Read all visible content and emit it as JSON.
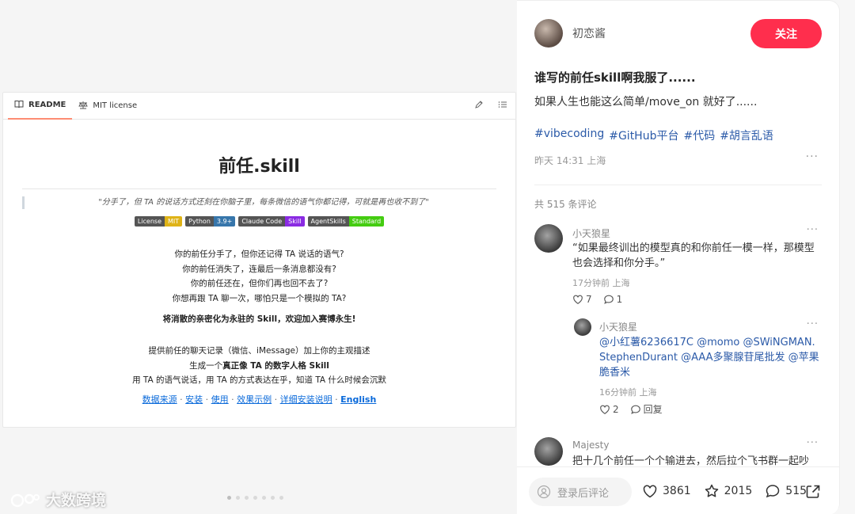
{
  "readme": {
    "tabs": [
      {
        "label": "README",
        "icon": "book-icon"
      },
      {
        "label": "MIT license",
        "icon": "scale-icon"
      }
    ],
    "title": "前任.skill",
    "quote": "\"分手了，但 TA 的说话方式还刻在你脑子里，每条微信的语气你都记得，可就是再也收不到了\"",
    "badges": [
      {
        "key": "License",
        "value": "MIT",
        "color": "#dfb317"
      },
      {
        "key": "Python",
        "value": "3.9+",
        "color": "#3776ab"
      },
      {
        "key": "Claude Code",
        "value": "Skill",
        "color": "#8a2be2"
      },
      {
        "key": "AgentSkills",
        "value": "Standard",
        "color": "#4c1"
      }
    ],
    "lines1": [
      "你的前任分手了，但你还记得 TA 说话的语气?",
      "你的前任消失了，连最后一条消息都没有?",
      "你的前任还在，但你们再也回不去了?",
      "你想再跟 TA 聊一次，哪怕只是一个模拟的 TA?"
    ],
    "bold_line": "将消散的亲密化为永驻的 Skill，欢迎加入赛博永生!",
    "lines2": {
      "l1": "提供前任的聊天记录（微信、iMessage）加上你的主观描述",
      "l2_pre": "生成一个",
      "l2_bold": "真正像 TA 的数字人格 Skill",
      "l3": "用 TA 的语气说话，用 TA 的方式表达在乎，知道 TA 什么时候会沉默"
    },
    "links": [
      "数据来源",
      "安装",
      "使用",
      "效果示例",
      "详细安装说明",
      "English"
    ],
    "sep": " · "
  },
  "watermark": "大数跨境",
  "post": {
    "author": "初恋酱",
    "follow_label": "关注",
    "title": "谁写的前任skill啊我服了......",
    "desc": "如果人生也能这么简单/move_on 就好了......",
    "tags": [
      "#vibecoding",
      "#GitHub平台",
      "#代码",
      "#胡言乱语"
    ],
    "meta": "昨天 14:31 上海",
    "more": "···",
    "comment_count": "共 515 条评论"
  },
  "comments": [
    {
      "name": "小天狼星",
      "text": "“如果最终训出的模型真的和你前任一模一样，那模型也会选择和你分手。”",
      "time": "17分钟前 上海",
      "likes": "7",
      "replies": "1"
    },
    {
      "name": "小天狼星",
      "mentions": "@小红薯6236617C @momo @SWiNGMAN.StephenDurant @AAA多聚腺苷尾批发 @苹果脆香米",
      "time": "16分钟前 上海",
      "likes": "2",
      "reply_label": "回复"
    },
    {
      "name": "Majesty",
      "text": "把十几个前任一个个输进去，然后拉个飞书群一起吵"
    }
  ],
  "bottom": {
    "input_placeholder": "登录后评论",
    "likes": "3861",
    "stars": "2015",
    "comments": "515"
  },
  "colors": {
    "accent": "#ff2e4d",
    "tag": "#2b5aa8",
    "link": "#0969da"
  }
}
